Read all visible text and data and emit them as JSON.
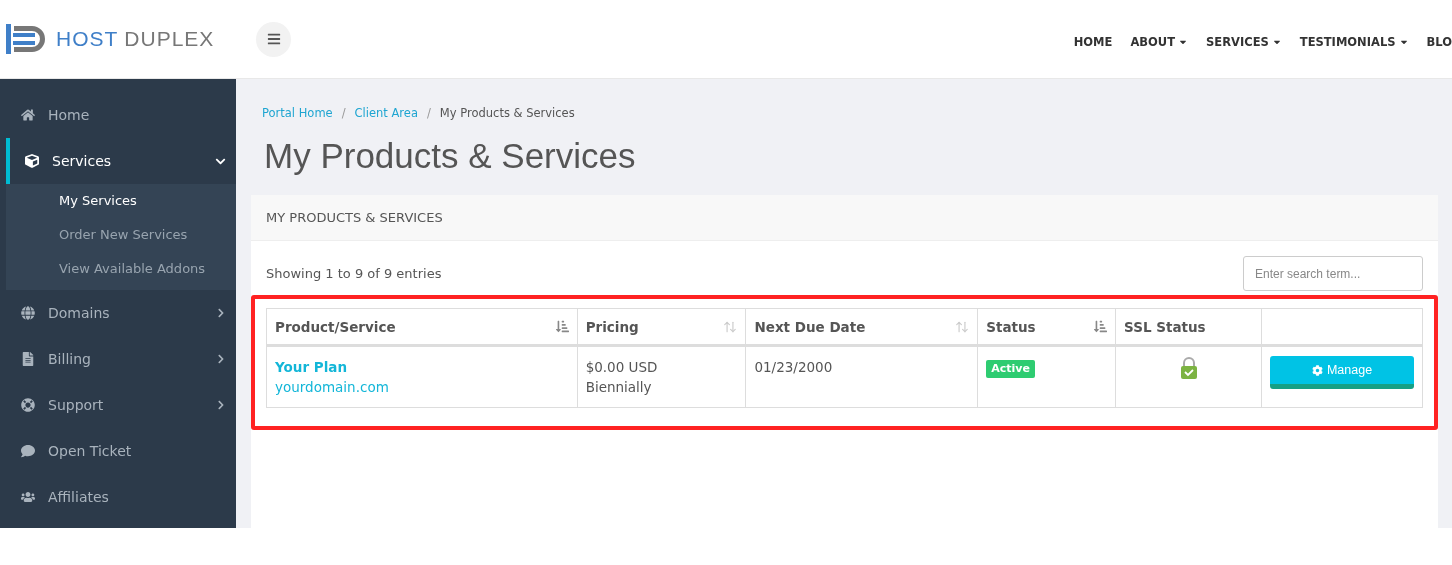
{
  "logo": {
    "first": "HOST",
    "second": "DUPLEX"
  },
  "top_nav": [
    {
      "label": "HOME",
      "has_dropdown": false
    },
    {
      "label": "ABOUT",
      "has_dropdown": true
    },
    {
      "label": "SERVICES",
      "has_dropdown": true
    },
    {
      "label": "TESTIMONIALS",
      "has_dropdown": true
    },
    {
      "label": "BLO",
      "has_dropdown": false
    }
  ],
  "sidebar": {
    "items": [
      {
        "label": "Home",
        "selected": false
      },
      {
        "label": "Services",
        "selected": true,
        "expanded": true,
        "children": [
          {
            "label": "My Services",
            "selected": true
          },
          {
            "label": "Order New Services",
            "selected": false
          },
          {
            "label": "View Available Addons",
            "selected": false
          }
        ]
      },
      {
        "label": "Domains",
        "selected": false,
        "expanded": false
      },
      {
        "label": "Billing",
        "selected": false,
        "expanded": false
      },
      {
        "label": "Support",
        "selected": false,
        "expanded": false
      },
      {
        "label": "Open Ticket",
        "selected": false
      },
      {
        "label": "Affiliates",
        "selected": false
      }
    ]
  },
  "breadcrumb": {
    "separator": "/",
    "items": [
      {
        "label": "Portal Home",
        "current": false
      },
      {
        "label": "Client Area",
        "current": false
      },
      {
        "label": "My Products & Services",
        "current": true
      }
    ]
  },
  "page_title": "My Products & Services",
  "panel": {
    "title": "MY PRODUCTS & SERVICES",
    "entries_info": "Showing 1 to 9 of 9 entries",
    "search": {
      "placeholder": "Enter search term..."
    },
    "table": {
      "columns": [
        {
          "label": "Product/Service",
          "sortable": true,
          "sorted": true
        },
        {
          "label": "Pricing",
          "sortable": true,
          "sorted": false
        },
        {
          "label": "Next Due Date",
          "sortable": true,
          "sorted": false
        },
        {
          "label": "Status",
          "sortable": true,
          "sorted": true
        },
        {
          "label": "SSL Status"
        },
        {}
      ],
      "rows": [
        {
          "product": "Your Plan",
          "domain": "yourdomain.com",
          "price": "$0.00 USD",
          "cycle": "Biennially",
          "due": "01/23/2000",
          "status": {
            "label": "Active",
            "color": "#2ecc71"
          },
          "ssl_secure": true,
          "action": "Manage"
        }
      ]
    }
  }
}
